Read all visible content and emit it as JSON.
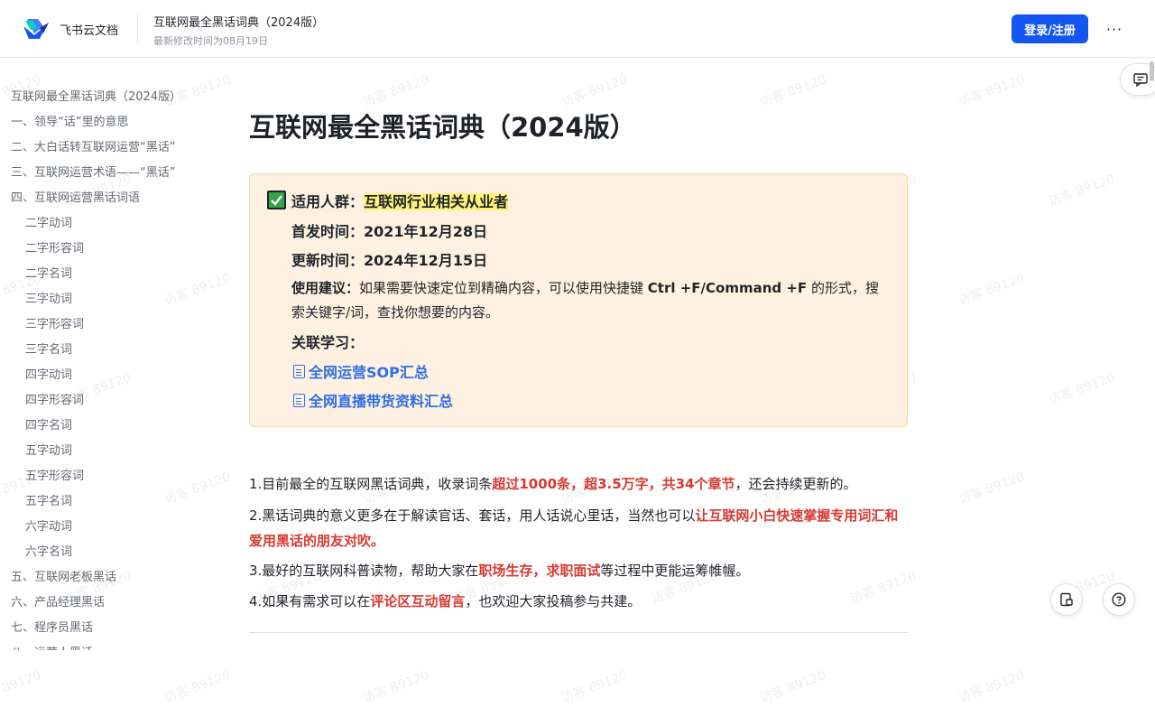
{
  "header": {
    "brand": "飞书云文档",
    "doc_title": "互联网最全黑话词典（2024版）",
    "doc_meta": "最新修改时间为08月19日",
    "login_label": "登录/注册",
    "more_label": "···"
  },
  "toc": [
    {
      "label": "互联网最全黑话词典（2024版）",
      "level": 1
    },
    {
      "label": "一、领导“话”里的意思",
      "level": 1
    },
    {
      "label": "二、大白话转互联网运营“黑话”",
      "level": 1
    },
    {
      "label": "三、互联网运营术语——“黑话”",
      "level": 1
    },
    {
      "label": "四、互联网运营黑话词语",
      "level": 1
    },
    {
      "label": "二字动词",
      "level": 2
    },
    {
      "label": "二字形容词",
      "level": 2
    },
    {
      "label": "二字名词",
      "level": 2
    },
    {
      "label": "三字动词",
      "level": 2
    },
    {
      "label": "三字形容词",
      "level": 2
    },
    {
      "label": "三字名词",
      "level": 2
    },
    {
      "label": "四字动词",
      "level": 2
    },
    {
      "label": "四字形容词",
      "level": 2
    },
    {
      "label": "四字名词",
      "level": 2
    },
    {
      "label": "五字动词",
      "level": 2
    },
    {
      "label": "五字形容词",
      "level": 2
    },
    {
      "label": "五字名词",
      "level": 2
    },
    {
      "label": "六字动词",
      "level": 2
    },
    {
      "label": "六字名词",
      "level": 2
    },
    {
      "label": "五、互联网老板黑话",
      "level": 1
    },
    {
      "label": "六、产品经理黑话",
      "level": 1
    },
    {
      "label": "七、程序员黑话",
      "level": 1
    },
    {
      "label": "八、运营人黑话",
      "level": 1
    }
  ],
  "main": {
    "title": "互联网最全黑话词典（2024版）",
    "callout": {
      "audience_label": "适用人群：",
      "audience_value": "互联网行业相关从业者",
      "first_label": "首发时间：",
      "first_value": "2021年12月28日",
      "update_label": "更新时间：",
      "update_value": "2024年12月15日",
      "tip_label": "使用建议：",
      "tip_text_1": "如果需要快速定位到精确内容，可以使用快捷键 ",
      "tip_shortcut": "Ctrl +F/Command +F",
      "tip_text_2": " 的形式，搜索关键字/词，查找你想要的内容。",
      "related_label": "关联学习：",
      "link_1": "全网运营SOP汇总",
      "link_2": "全网直播带货资料汇总"
    },
    "list": [
      {
        "pre": "1.目前最全的互联网黑话词典，收录词条",
        "em": "超过1000条，超3.5万字，共34个章节",
        "post": "，还会持续更新的。"
      },
      {
        "pre": "2.黑话词典的意义更多在于解读官话、套话，用人话说心里话，当然也可以",
        "em": "让互联网小白快速掌握专用词汇和爱用黑话的朋友对吹。",
        "post": ""
      },
      {
        "pre": "3.最好的互联网科普读物，帮助大家在",
        "em": "职场生存，求职面试",
        "post": "等过程中更能运筹帷幄。"
      },
      {
        "pre": "4.如果有需求可以在",
        "em": "评论区互动留言",
        "post": "，也欢迎大家投稿参与共建。"
      }
    ]
  },
  "watermark": "访客 89120",
  "colors": {
    "accent": "#1456f0",
    "link": "#2f6fe4",
    "emphasis": "#d83931",
    "callout_bg": "#fef1e1"
  }
}
